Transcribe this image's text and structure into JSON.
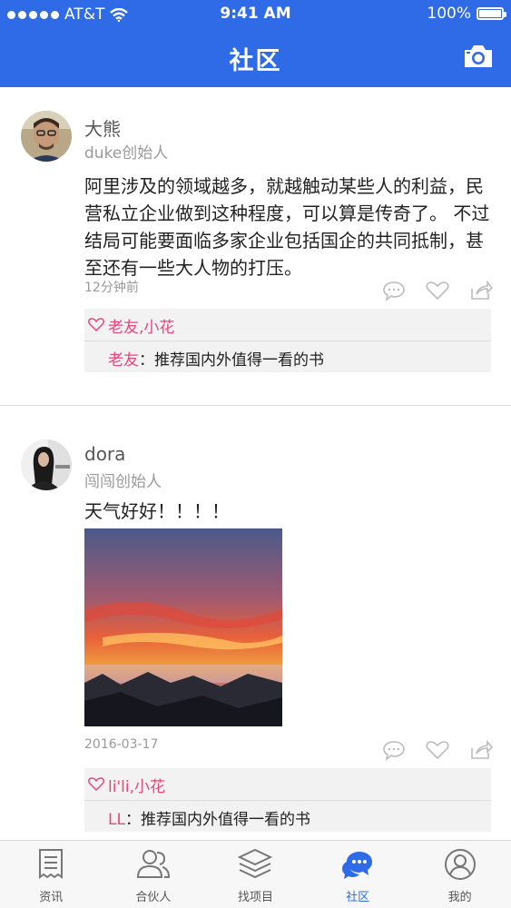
{
  "status_bar": {
    "carrier": "AT&T",
    "time": "9:41 AM",
    "battery": "100%"
  },
  "header": {
    "title": "社区",
    "camera_icon": "camera-icon"
  },
  "posts": [
    {
      "name": "大熊",
      "role": "duke创始人",
      "text": "阿里涉及的领域越多，就越触动某些人的利益，民营私立企业做到这种程度，可以算是传奇了。 不过结局可能要面临多家企业包括国企的共同抵制，甚至还有一些大人物的打压。",
      "time": "12分钟前",
      "likes": "老友,小花",
      "comment_author": "老友",
      "comment_text": "推荐国内外值得一看的书"
    },
    {
      "name": "dora",
      "role": "闯闯创始人",
      "text": "天气好好！！！！",
      "time": "2016-03-17",
      "likes": "li'li,小花",
      "comment_author": "LL",
      "comment_text": "推荐国内外值得一看的书",
      "image": "sunset-over-mountains-photo"
    }
  ],
  "tabs": [
    {
      "label": "资讯",
      "icon": "news-icon"
    },
    {
      "label": "合伙人",
      "icon": "partners-icon"
    },
    {
      "label": "找项目",
      "icon": "projects-icon"
    },
    {
      "label": "社区",
      "icon": "community-icon",
      "active": true
    },
    {
      "label": "我的",
      "icon": "profile-icon"
    }
  ],
  "colors": {
    "primary": "#2f6be6",
    "like": "#e8467d"
  }
}
